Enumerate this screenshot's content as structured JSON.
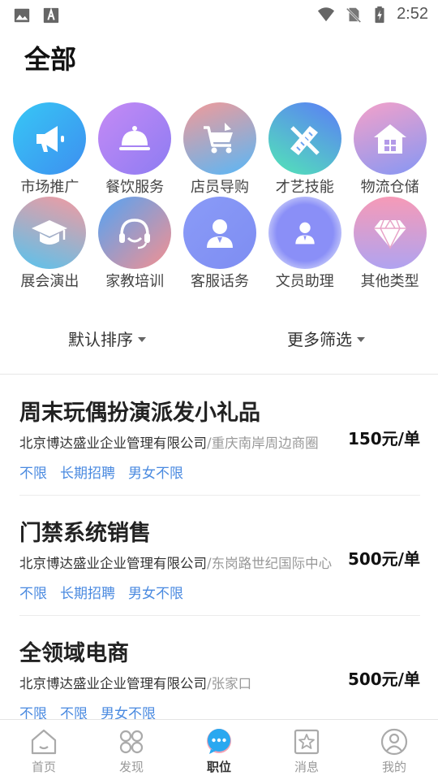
{
  "status_bar": {
    "time": "2:52",
    "icons": [
      "image-icon",
      "font-icon",
      "wifi-icon",
      "no-sim-icon",
      "battery-charging-icon"
    ]
  },
  "page_title": "全部",
  "categories": [
    {
      "label": "市场推广",
      "icon": "megaphone-icon",
      "gradient": [
        "#37c7f5",
        "#3d8ff0"
      ]
    },
    {
      "label": "餐饮服务",
      "icon": "cloche-icon",
      "gradient": [
        "#c58af5",
        "#8d7cf2"
      ]
    },
    {
      "label": "店员导购",
      "icon": "shopping-cart-icon",
      "gradient": [
        "#f39a98",
        "#58b7f7"
      ]
    },
    {
      "label": "才艺技能",
      "icon": "ruler-pencil-icon",
      "gradient": [
        "#5b7cf7",
        "#52e6b6"
      ]
    },
    {
      "label": "物流仓储",
      "icon": "warehouse-icon",
      "gradient": [
        "#f5a1c9",
        "#8597f4"
      ]
    },
    {
      "label": "展会演出",
      "icon": "graduation-cap-icon",
      "gradient": [
        "#f49aa0",
        "#56c3ee"
      ]
    },
    {
      "label": "家教培训",
      "icon": "headset-icon",
      "gradient": [
        "#53a3f4",
        "#f59090"
      ]
    },
    {
      "label": "客服话务",
      "icon": "customer-service-icon",
      "gradient": [
        "#8a9bf7",
        "#7e8df2"
      ]
    },
    {
      "label": "文员助理",
      "icon": "clerk-icon",
      "gradient": [
        "#8a8ff7",
        "#6c86f0"
      ]
    },
    {
      "label": "其他类型",
      "icon": "diamond-icon",
      "gradient": [
        "#f69ab7",
        "#b0a3f0"
      ]
    }
  ],
  "filters": {
    "sort_label": "默认排序",
    "more_label": "更多筛选"
  },
  "jobs": [
    {
      "title": "周末玩偶扮演派发小礼品",
      "company": "北京博达盛业企业管理有限公司",
      "separator": "/",
      "location": "重庆南岸周边商圈",
      "price": "150元/单",
      "tags": [
        "不限",
        "长期招聘",
        "男女不限"
      ]
    },
    {
      "title": "门禁系统销售",
      "company": "北京博达盛业企业管理有限公司",
      "separator": "/",
      "location": "东岗路世纪国际中心",
      "price": "500元/单",
      "tags": [
        "不限",
        "长期招聘",
        "男女不限"
      ]
    },
    {
      "title": "全领域电商",
      "company": "北京博达盛业企业管理有限公司",
      "separator": "/",
      "location": "张家口",
      "price": "500元/单",
      "tags": [
        "不限",
        "不限",
        "男女不限"
      ]
    }
  ],
  "bottom_nav": [
    {
      "label": "首页",
      "icon": "home-icon",
      "active": false
    },
    {
      "label": "发现",
      "icon": "discover-icon",
      "active": false
    },
    {
      "label": "职位",
      "icon": "chat-bubble-icon",
      "active": true
    },
    {
      "label": "消息",
      "icon": "message-star-icon",
      "active": false
    },
    {
      "label": "我的",
      "icon": "profile-icon",
      "active": false
    }
  ],
  "colors": {
    "tag": "#4a8ae0",
    "active_nav": "#2aa8f0"
  }
}
